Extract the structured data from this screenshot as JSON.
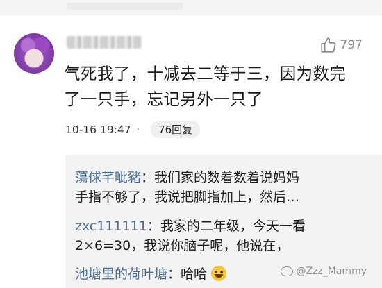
{
  "comment": {
    "username": "",
    "like_count": "797",
    "text_line1": "气死我了，十减去二等于三，因为数完",
    "text_line2": "了一只手，忘记另外一只了",
    "timestamp": "10-16 19:47",
    "separator": "·",
    "reply_count": "76回复"
  },
  "replies": [
    {
      "name": "蕩俅芊呲豬",
      "line1_rest": "：我们家的数着数着说妈妈",
      "line2": "手指不够了，我说把脚指加上，然后…"
    },
    {
      "name": "zxc111111",
      "line1_rest": "：我家的二年级，今天一看",
      "line2": "2×6=30，我说你脑子呢，他说在，"
    },
    {
      "name": "池塘里的荷叶塘",
      "line1_rest": "：哈哈"
    }
  ],
  "watermark": "@Zzz_Mammy",
  "icons": [
    "thumbs-up-icon",
    "smile-emoji-icon",
    "weibo-logo-icon"
  ],
  "colors": {
    "name_link": "#4a6e9a",
    "reply_bg": "#f3f3f3",
    "muted": "#8a8a8a"
  }
}
